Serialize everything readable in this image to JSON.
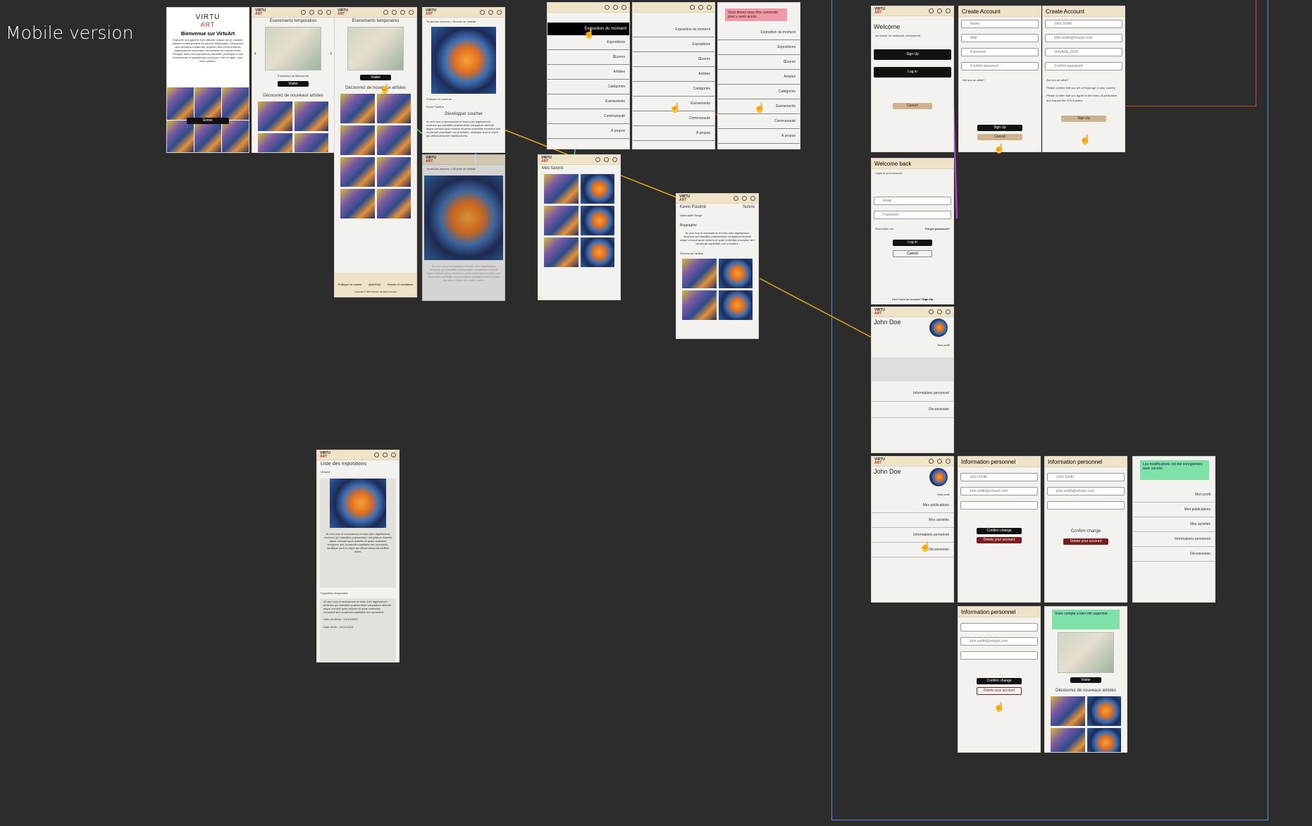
{
  "canvas": {
    "title": "Mobile version"
  },
  "logo": {
    "top": "VIRTU",
    "bottom": "ART"
  },
  "home": {
    "title": "Bienvenue sur VirtuArt",
    "intro": "Explorez une galerie d'art virtuelle unique où se croisent artistes contemporains et œuvres historiques. Découvrez des créations modernes, admirez des chefs-d'œuvre classiques et rencontrez des artistes du monde entier. Plongez dans nos expositions virtuelles, participez à nos événements et passionnez-vous pour l'art en ligne, pour tous, partout.",
    "enter_button": "Entrer"
  },
  "events": {
    "section_title": "Évenements temporaires",
    "card_label": "Exposition de Bienvenue",
    "visit_button": "Visiter",
    "discover_title": "Découvrez de nouveaux artistes"
  },
  "artwork": {
    "breadcrumb": "Toutes les œuvres > Œuvres de l'artiste",
    "caption": "Poisson en couleurs",
    "artist": "Kevin Poutiné",
    "expand": "Développer coucher",
    "description": "At vero eos et accusamus et iusto odio dignissimos ducimus qui blanditiis praesentium voluptatum deleniti atque corrupti quos dolores et quas molestias excepturi sint occaecati cupiditate non provident, similique sunt in culpa qui officia deserunt mollitia animi."
  },
  "menu": {
    "highlight": "Exposition du moment",
    "items": [
      "Exposition du moment",
      "Expositions",
      "Œuvres",
      "Artistes",
      "Catégories",
      "Événements",
      "Communauté",
      "À propos"
    ],
    "locked_alert": "Vous devez vous être connecter pour y avoir accès"
  },
  "favorites": {
    "title": "Mes favoris"
  },
  "artist_page": {
    "name": "Kevin Poutiné",
    "nationality": "Nationalité: Belge",
    "follow": "Suivre",
    "bio_title": "Biographie",
    "bio": "At vero eos et accusamus et iusto odio dignissimos ducimus qui blanditiis praesentium voluptatum deleniti atque corrupti quos dolores et quas molestias excepturi sint occaecati cupiditate non provident.",
    "works_title": "Œuvres de l'artiste"
  },
  "expo_list": {
    "title": "Liste des expositions",
    "subtitle": "VirtuArt",
    "section": "Exposition temporaire",
    "date_start": "Date de début : 10/10/2024",
    "date_end": "Date de fin : 10/11/2024"
  },
  "footer": {
    "links": [
      "Politique de cookie",
      "Aide/FAQ",
      "Termes et conditions"
    ],
    "copy": "Copyright © 2024 VirtuArt, all rights reserved"
  },
  "auth": {
    "welcome": "Welcome",
    "welcome_sub": "Art online, for everyone, everywhere.",
    "sign_up": "Sign Up",
    "log_in": "Log in",
    "cancel": "Cancel",
    "create_account": "Create Account",
    "name_ph": "Name",
    "mail_ph": "Mail",
    "password_ph": "Password",
    "confirm_ph": "Confirm password",
    "artist_q": "Are you an artist?",
    "filled_name": "John Smith",
    "filled_mail": "john.smith@virtuart.com",
    "filled_pw": "VirtuArt&_2024",
    "terms": "Please confirm that you agree to the terms of publication and respect the GTU's policy",
    "age": "Please confirm that you are of legal age in your country",
    "welcome_back": "Welcome back",
    "login_sub": "Login to your Account",
    "email_ph": "Email",
    "remember": "Remember me",
    "forgot": "Forgot password?",
    "no_account": "Don't have an account?",
    "sign_up_link": "Sign Up"
  },
  "profile": {
    "name": "John Doe",
    "my_profile": "Mon profil",
    "items": [
      "Mes publications",
      "Mes activités",
      "Informations personnel",
      "Déconnexion"
    ],
    "info_title": "Information personnel",
    "info_name": "John Smith",
    "info_mail": "john.smith@virtuart.com",
    "confirm": "Confirm change",
    "delete": "Delete your account",
    "success": "Les modifications ont été enregistrées avec succès.",
    "deleted": "Votre compte a bien été supprimé."
  }
}
